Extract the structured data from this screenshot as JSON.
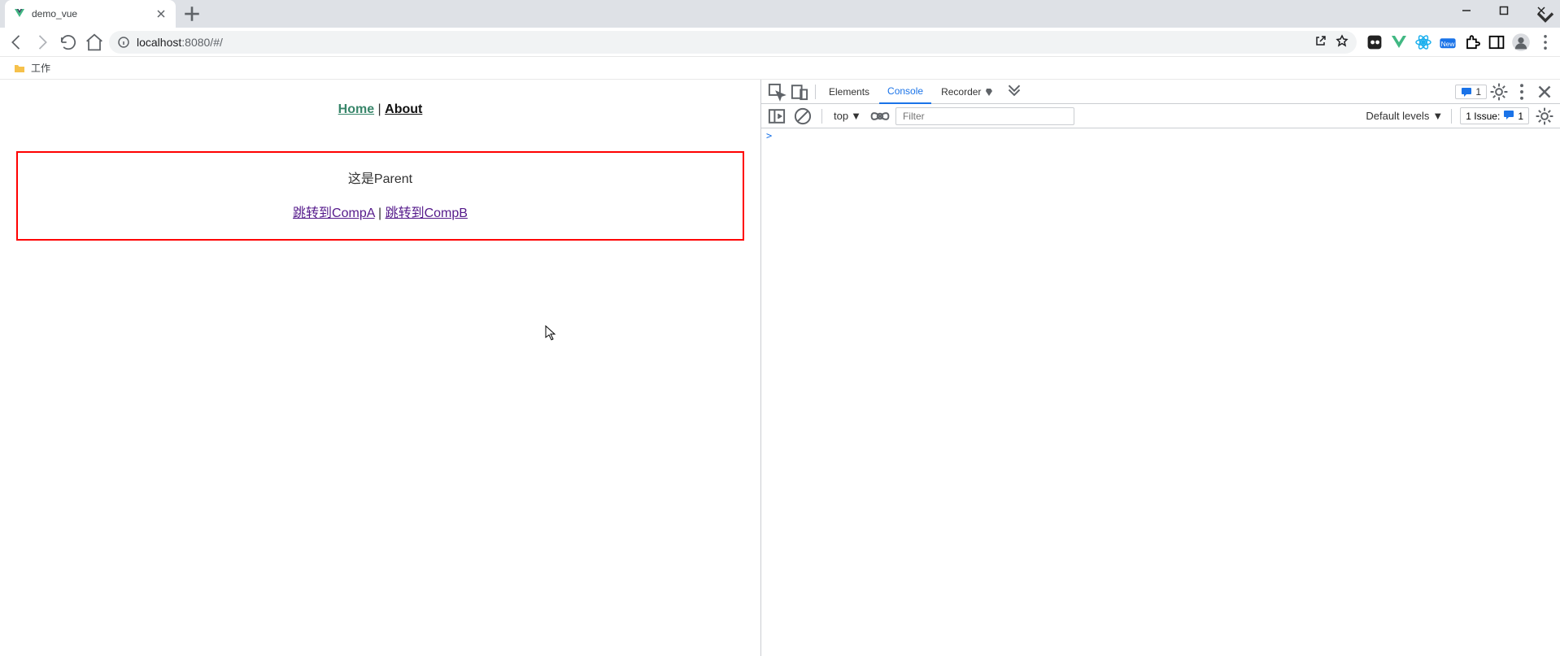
{
  "browser": {
    "tab_title": "demo_vue",
    "url_host": "localhost",
    "url_port_path": ":8080/#/",
    "bookmark_label": "工作"
  },
  "page": {
    "nav": {
      "home": "Home",
      "sep": " | ",
      "about": "About"
    },
    "parent": {
      "title": "这是Parent",
      "link_a": "跳转到CompA",
      "sep": " | ",
      "link_b": "跳转到CompB"
    }
  },
  "devtools": {
    "tabs": {
      "elements": "Elements",
      "console": "Console",
      "recorder": "Recorder"
    },
    "header_badge_count": "1",
    "console_bar": {
      "context": "top",
      "filter_placeholder": "Filter",
      "levels": "Default levels",
      "issues_label": "1 Issue:",
      "issues_count": "1"
    },
    "prompt": ">"
  }
}
